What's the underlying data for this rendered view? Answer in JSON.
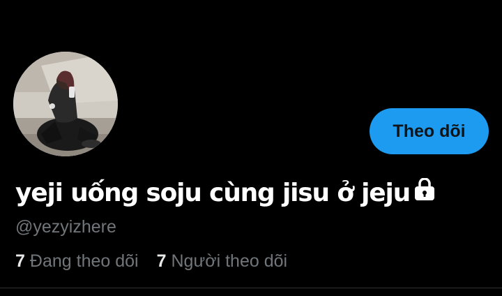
{
  "profile": {
    "display_name": "yeji uống soju cùng jisu ở jeju",
    "handle": "@yezyizhere",
    "protected_icon": "lock-icon",
    "avatar": "profile-photo",
    "follow_button_label": "Theo dõi"
  },
  "stats": {
    "following_count": "7",
    "following_label": "Đang theo dõi",
    "followers_count": "7",
    "followers_label": "Người theo dõi"
  },
  "colors": {
    "background": "#000000",
    "accent": "#1d9bf0",
    "secondary_text": "#71767b",
    "primary_text": "#ffffff"
  }
}
